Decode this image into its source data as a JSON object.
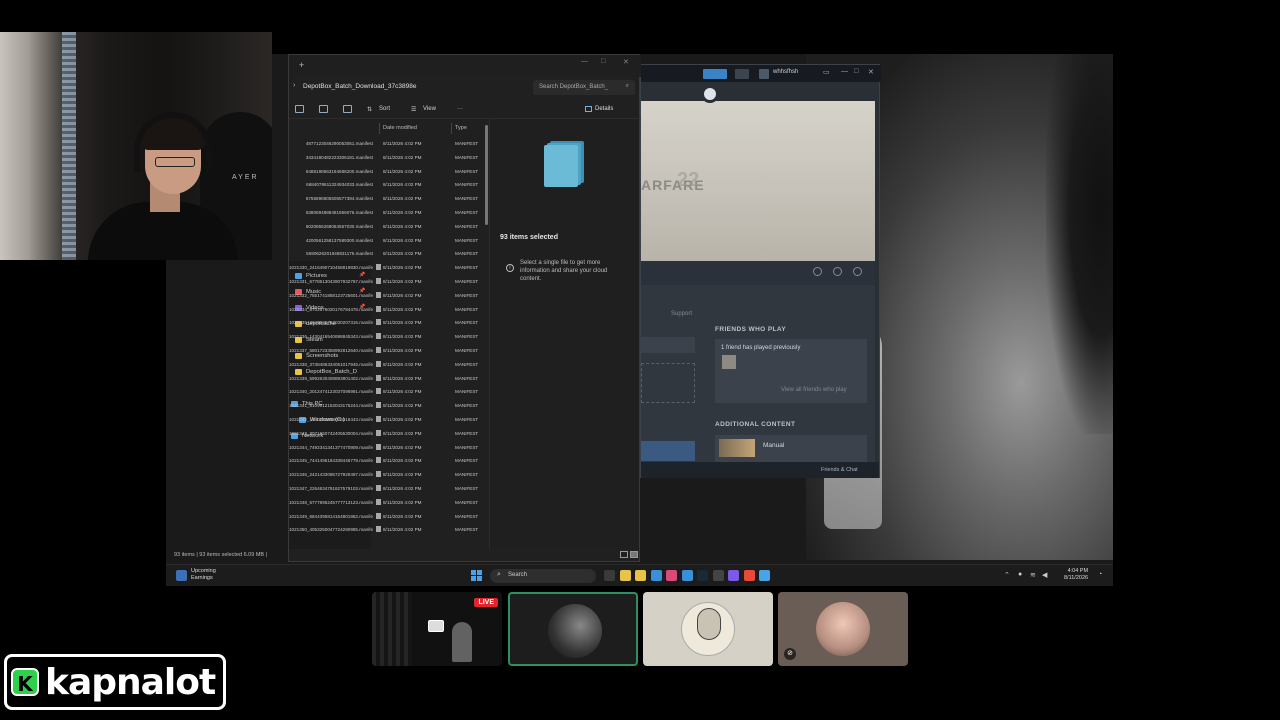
{
  "explorer": {
    "tab_add": "+",
    "address": "DepotBox_Batch_Download_37c3898e",
    "search_placeholder": "Search DepotBox_Batch_",
    "toolbar": {
      "sort": "Sort",
      "view": "View",
      "more": "···",
      "details": "Details"
    },
    "columns": {
      "date": "Date modified",
      "type": "Type"
    },
    "nav": [
      {
        "label": "Pictures",
        "color": "#4aa3e8"
      },
      {
        "label": "Music",
        "color": "#e85a5a"
      },
      {
        "label": "Videos",
        "color": "#8a5ae8"
      },
      {
        "label": "depotcache",
        "color": "#e8c34a"
      },
      {
        "label": "Steam",
        "color": "#e8c34a"
      },
      {
        "label": "Screenshots",
        "color": "#e8c34a"
      },
      {
        "label": "DepotBox_Batch_D",
        "color": "#e8c34a"
      },
      {
        "label": "This PC",
        "color": "#4aa3e8"
      },
      {
        "label": "Windows (C:)",
        "color": "#4aa3e8"
      },
      {
        "label": "Network",
        "color": "#4aa3e8"
      }
    ],
    "rows": [
      {
        "name": "4877123046290053051.manifest",
        "date": "8/11/2026 4:02 PM",
        "type": "MANIFEST"
      },
      {
        "name": "3434180482223306181.manifest",
        "date": "8/11/2026 4:02 PM",
        "type": "MANIFEST"
      },
      {
        "name": "6488198563194686200.manifest",
        "date": "8/11/2026 4:02 PM",
        "type": "MANIFEST"
      },
      {
        "name": "6684078611324934033.manifest",
        "date": "8/11/2026 4:02 PM",
        "type": "MANIFEST"
      },
      {
        "name": "6755898605505577394.manifest",
        "date": "8/11/2026 4:02 PM",
        "type": "MANIFEST"
      },
      {
        "name": "6380694888481956076.manifest",
        "date": "8/11/2026 4:02 PM",
        "type": "MANIFEST"
      },
      {
        "name": "6020856268084557030.manifest",
        "date": "8/11/2026 4:02 PM",
        "type": "MANIFEST"
      },
      {
        "name": "4200561258137589300.manifest",
        "date": "8/11/2026 4:02 PM",
        "type": "MANIFEST"
      },
      {
        "name": "5590626201948831175.manifest",
        "date": "8/11/2026 4:02 PM",
        "type": "MANIFEST"
      },
      {
        "name": "1021330_2416490710458819830.manifest",
        "date": "8/11/2026 4:02 PM",
        "type": "MANIFEST"
      },
      {
        "name": "1021331_6778513043907932767.manifest",
        "date": "8/11/2026 4:02 PM",
        "type": "MANIFEST"
      },
      {
        "name": "1021332_7551741858123725601.manifest",
        "date": "8/11/2026 4:02 PM",
        "type": "MANIFEST"
      },
      {
        "name": "1021334_8702676020176784476.manifest",
        "date": "8/11/2026 4:02 PM",
        "type": "MANIFEST"
      },
      {
        "name": "1021335_2845925753030207316.manifest",
        "date": "8/11/2026 4:02 PM",
        "type": "MANIFEST"
      },
      {
        "name": "1021336_1430416540698845343.manifest",
        "date": "8/11/2026 4:02 PM",
        "type": "MANIFEST"
      },
      {
        "name": "1021337_5801723358992812640.manifest",
        "date": "8/11/2026 4:02 PM",
        "type": "MANIFEST"
      },
      {
        "name": "1021338_3738485334051017945.manifest",
        "date": "8/11/2026 4:02 PM",
        "type": "MANIFEST"
      },
      {
        "name": "1021339_5992630408893801402.manifest",
        "date": "8/11/2026 4:02 PM",
        "type": "MANIFEST"
      },
      {
        "name": "1021340_2012474123037096991.manifest",
        "date": "8/11/2026 4:02 PM",
        "type": "MANIFEST"
      },
      {
        "name": "1021341_6109912153043175244.manifest",
        "date": "8/11/2026 4:02 PM",
        "type": "MANIFEST"
      },
      {
        "name": "1021342_1540234868025618443.manifest",
        "date": "8/11/2026 4:02 PM",
        "type": "MANIFEST"
      },
      {
        "name": "1021343_3071650742405530004.manifest",
        "date": "8/11/2026 4:02 PM",
        "type": "MANIFEST"
      },
      {
        "name": "1021344_7492341341377470909.manifest",
        "date": "8/11/2026 4:02 PM",
        "type": "MANIFEST"
      },
      {
        "name": "1021345_7441496184339446778.manifest",
        "date": "8/11/2026 4:02 PM",
        "type": "MANIFEST"
      },
      {
        "name": "1021346_2421433095727929497.manifest",
        "date": "8/11/2026 4:02 PM",
        "type": "MANIFEST"
      },
      {
        "name": "1021347_2264634751627579103.manifest",
        "date": "8/11/2026 4:02 PM",
        "type": "MANIFEST"
      },
      {
        "name": "1021348_5777895245777713123.manifest",
        "date": "8/11/2026 4:02 PM",
        "type": "MANIFEST"
      },
      {
        "name": "1021349_6844395814154801862.manifest",
        "date": "8/11/2026 4:02 PM",
        "type": "MANIFEST"
      },
      {
        "name": "1021350_4053250047724290985.manifest",
        "date": "8/11/2026 4:02 PM",
        "type": "MANIFEST"
      }
    ],
    "details": {
      "selected": "93 items selected",
      "info": "Select a single file to get more information and share your cloud content."
    },
    "status": "93 items  |  93 items selected  6.09 MB  |"
  },
  "steam": {
    "username": "whhsfhsh",
    "hero_title": "ARFARE",
    "hero_number": "22",
    "support": "Support",
    "friends_heading": "FRIENDS WHO PLAY",
    "friends_played": "1 friend has played previously",
    "view_all": "View all friends who play",
    "additional_heading": "ADDITIONAL CONTENT",
    "manual": "Manual",
    "friends_chat": "Friends & Chat"
  },
  "taskbar": {
    "weather_line1": "Upcoming",
    "weather_line2": "Earnings",
    "search": "Search",
    "time": "4:04 PM",
    "date": "8/11/2026",
    "apps": [
      "#3a3a3a",
      "#e8c34a",
      "#e8c34a",
      "#3b8fd9",
      "#d94a7a",
      "#3a8fd9",
      "#1b2838",
      "#444",
      "#7a5ae8",
      "#e84a3a",
      "#4aa3e8"
    ]
  },
  "stream": {
    "live_label": "LIVE",
    "chair_brand": "AYER",
    "channel_letter": "K",
    "channel_name": "kapnalot"
  }
}
